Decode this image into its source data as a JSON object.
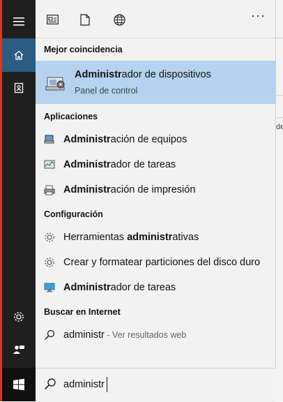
{
  "topbar": {
    "icons": [
      "apps-icon",
      "document-icon",
      "globe-icon"
    ],
    "more_label": "···"
  },
  "best_match": {
    "header": "Mejor coincidencia",
    "title_bold": "Administr",
    "title_rest": "ador de dispositivos",
    "subtitle": "Panel de control"
  },
  "apps": {
    "header": "Aplicaciones",
    "items": [
      {
        "bold": "Administr",
        "rest": "ación de equipos"
      },
      {
        "bold": "Administr",
        "rest": "ador de tareas"
      },
      {
        "bold": "Administr",
        "rest": "ación de impresión"
      }
    ]
  },
  "config": {
    "header": "Configuración",
    "items": [
      {
        "pre": "Herramientas ",
        "bold": "administr",
        "rest": "ativas"
      },
      {
        "pre": "Crear y formatear particiones del disco duro",
        "bold": "",
        "rest": ""
      },
      {
        "pre": "",
        "bold": "Administr",
        "rest": "ador de tareas"
      }
    ]
  },
  "web": {
    "header": "Buscar en Internet",
    "query": "administr",
    "hint": " - Ver resultados web"
  },
  "search": {
    "value": "administr"
  },
  "background": {
    "fragment": "de"
  },
  "colors": {
    "rail": "#1f1f1f",
    "active": "#2b5d84",
    "highlight": "#b5d3ee"
  }
}
